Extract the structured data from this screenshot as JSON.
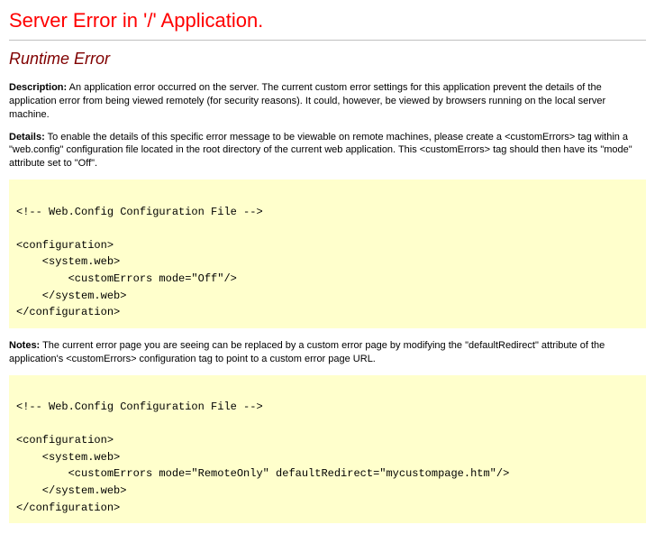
{
  "header": {
    "title": "Server Error in '/' Application."
  },
  "subheader": "Runtime Error",
  "description": {
    "label": "Description:",
    "text": " An application error occurred on the server. The current custom error settings for this application prevent the details of the application error from being viewed remotely (for security reasons). It could, however, be viewed by browsers running on the local server machine."
  },
  "details": {
    "label": "Details:",
    "text": " To enable the details of this specific error message to be viewable on remote machines, please create a <customErrors> tag within a \"web.config\" configuration file located in the root directory of the current web application. This <customErrors> tag should then have its \"mode\" attribute set to \"Off\"."
  },
  "codeblock1": "\n<!-- Web.Config Configuration File -->\n\n<configuration>\n    <system.web>\n        <customErrors mode=\"Off\"/>\n    </system.web>\n</configuration>\n",
  "notes": {
    "label": "Notes:",
    "text": " The current error page you are seeing can be replaced by a custom error page by modifying the \"defaultRedirect\" attribute of the application's <customErrors> configuration tag to point to a custom error page URL."
  },
  "codeblock2": "\n<!-- Web.Config Configuration File -->\n\n<configuration>\n    <system.web>\n        <customErrors mode=\"RemoteOnly\" defaultRedirect=\"mycustompage.htm\"/>\n    </system.web>\n</configuration>\n"
}
